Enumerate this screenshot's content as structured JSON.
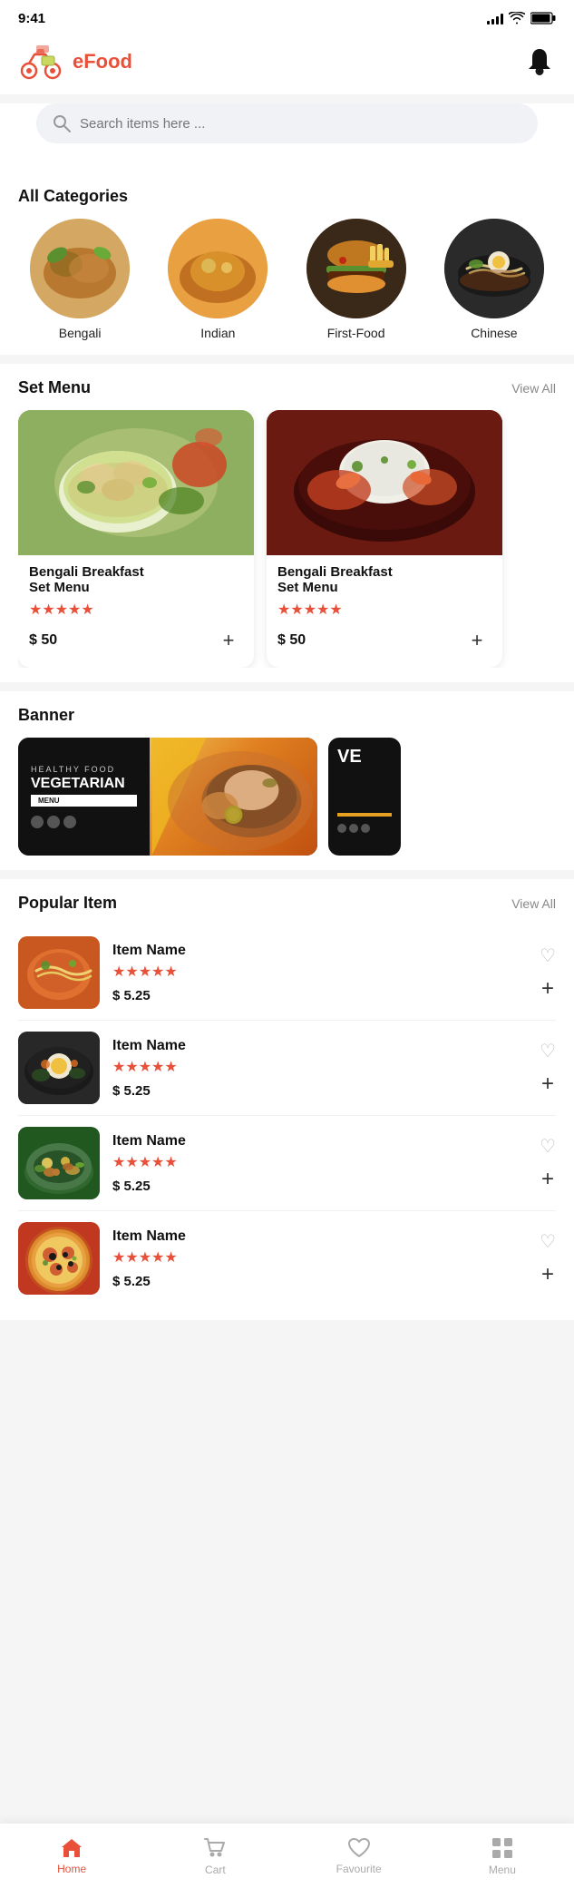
{
  "statusBar": {
    "time": "9:41",
    "signalBars": [
      4,
      6,
      9,
      12,
      14
    ],
    "batteryLevel": 80
  },
  "header": {
    "appName": "eFood",
    "logoAlt": "eFood logo"
  },
  "search": {
    "placeholder": "Search items here ..."
  },
  "categories": {
    "sectionTitle": "All Categories",
    "items": [
      {
        "id": "bengali",
        "label": "Bengali",
        "imgClass": "food-img-bengali"
      },
      {
        "id": "indian",
        "label": "Indian",
        "imgClass": "food-img-indian"
      },
      {
        "id": "fastfood",
        "label": "First-Food",
        "imgClass": "food-img-fastfood"
      },
      {
        "id": "chinese",
        "label": "Chinese",
        "imgClass": "food-img-chinese"
      }
    ]
  },
  "setMenu": {
    "sectionTitle": "Set Menu",
    "viewAllLabel": "View All",
    "items": [
      {
        "name": "Bengali Breakfast\nSet Menu",
        "nameFormatted": "Bengali Breakfast Set Menu",
        "stars": "★★★★★",
        "price": "$ 50",
        "imgClass": "food-img-set1"
      },
      {
        "name": "Bengali Breakfast\nSet Menu",
        "nameFormatted": "Bengali Breakfast Set Menu",
        "stars": "★★★★★",
        "price": "$ 50",
        "imgClass": "food-img-set2"
      }
    ]
  },
  "banner": {
    "sectionTitle": "Banner",
    "items": [
      {
        "healthyText": "HEALTHY FOOD",
        "mainText": "VEGETARIAN",
        "menuLabel": "MENU",
        "socialIcons": [
          "facebook",
          "twitter",
          "instagram"
        ]
      },
      {
        "mainText": "VE"
      }
    ]
  },
  "popularItems": {
    "sectionTitle": "Popular Item",
    "viewAllLabel": "View All",
    "items": [
      {
        "name": "Item Name",
        "stars": "★★★★★",
        "price": "$ 5.25",
        "imgClass": "food-img-pop1"
      },
      {
        "name": "Item Name",
        "stars": "★★★★★",
        "price": "$ 5.25",
        "imgClass": "food-img-pop2"
      },
      {
        "name": "Item Name",
        "stars": "★★★★★",
        "price": "$ 5.25",
        "imgClass": "food-img-pop3"
      },
      {
        "name": "Item Name",
        "stars": "★★★★★",
        "price": "$ 5.25",
        "imgClass": "food-img-pop4"
      }
    ]
  },
  "bottomNav": {
    "items": [
      {
        "id": "home",
        "label": "Home",
        "icon": "⌂",
        "active": true
      },
      {
        "id": "cart",
        "label": "Cart",
        "icon": "🛒",
        "active": false
      },
      {
        "id": "favourite",
        "label": "Favourite",
        "icon": "♡",
        "active": false
      },
      {
        "id": "menu",
        "label": "Menu",
        "icon": "⊞",
        "active": false
      }
    ]
  },
  "addButtonLabel": "+",
  "heartIconEmpty": "♡"
}
